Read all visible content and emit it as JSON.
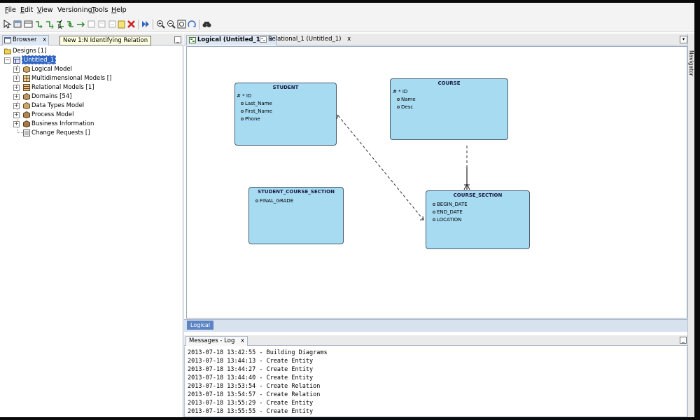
{
  "menubar": {
    "items": [
      {
        "label": "File",
        "mnemonic": "F",
        "rest": "ile"
      },
      {
        "label": "Edit",
        "mnemonic": "E",
        "rest": "dit"
      },
      {
        "label": "View",
        "mnemonic": "V",
        "rest": "iew"
      },
      {
        "label": "Versioning",
        "mnemonic": "",
        "rest": "Versioning"
      },
      {
        "label": "Tools",
        "mnemonic": "T",
        "rest": "ools"
      },
      {
        "label": "Help",
        "mnemonic": "H",
        "rest": "elp"
      }
    ]
  },
  "toolbar": {
    "tooltip": "New 1:N Identifying Relation",
    "icons": [
      "select-icon",
      "new-entity-icon",
      "new-view-icon",
      "new-relation-icon",
      "new-1n-relation-icon",
      "new-1n-identifying-relation-icon",
      "new-arc-icon",
      "new-fk-icon",
      "new-note-icon",
      "new-note2-icon",
      "new-note3-icon",
      "new-folder-icon",
      "delete-icon",
      "engineer-icon",
      "zoom-in-icon",
      "zoom-out-icon",
      "fit-screen-icon",
      "layout-icon",
      "find-icon"
    ]
  },
  "browser": {
    "tab_label": "Browser",
    "close": "x",
    "minimize": "_",
    "tree": {
      "root": "Designs [1]",
      "design": "Untitled_1",
      "children": [
        {
          "label": "Logical Model",
          "icon": "logical-model-icon",
          "expandable": true
        },
        {
          "label": "Multidimensional Models []",
          "icon": "multidimensional-icon",
          "expandable": true
        },
        {
          "label": "Relational Models [1]",
          "icon": "relational-models-icon",
          "expandable": true
        },
        {
          "label": "Domains [54]",
          "icon": "domains-icon",
          "expandable": true
        },
        {
          "label": "Data Types Model",
          "icon": "data-types-icon",
          "expandable": true
        },
        {
          "label": "Process Model",
          "icon": "process-model-icon",
          "expandable": true
        },
        {
          "label": "Business Information",
          "icon": "business-info-icon",
          "expandable": true
        },
        {
          "label": "Change Requests []",
          "icon": "change-requests-icon",
          "expandable": false
        }
      ]
    }
  },
  "editor": {
    "tabs": [
      {
        "label": "Logical (Untitled_1)",
        "active": true,
        "close": "x"
      },
      {
        "label": "Relational_1 (Untitled_1)",
        "active": false,
        "close": "x"
      }
    ],
    "menu_button": "▾",
    "navigator_label": "Navigator",
    "bottom_tab": "Logical"
  },
  "diagram": {
    "entities": [
      {
        "name": "STUDENT",
        "attributes": [
          "# * ID",
          "Last_Name",
          "First_Name",
          "Phone"
        ]
      },
      {
        "name": "COURSE",
        "attributes": [
          "# * ID",
          "Name",
          "Desc"
        ]
      },
      {
        "name": "STUDENT_COURSE_SECTION",
        "attributes": [
          "FINAL_GRADE"
        ]
      },
      {
        "name": "COURSE_SECTION",
        "attributes": [
          "BEGIN_DATE",
          "END_DATE",
          "LOCATION"
        ]
      }
    ],
    "relations": [
      {
        "from": "STUDENT",
        "to": "COURSE_SECTION",
        "style": "dashed"
      },
      {
        "from": "COURSE",
        "to": "COURSE_SECTION",
        "style": "dashed-solid"
      }
    ]
  },
  "messages": {
    "tab_label": "Messages - Log",
    "close": "x",
    "minimize": "_",
    "lines": [
      "2013-07-18 13:42:55 - Building Diagrams",
      "2013-07-18 13:44:13 - Create Entity",
      "2013-07-18 13:44:27 - Create Entity",
      "2013-07-18 13:44:40 - Create Entity",
      "2013-07-18 13:53:54 - Create Relation",
      "2013-07-18 13:54:57 - Create Relation",
      "2013-07-18 13:55:29 - Create Entity",
      "2013-07-18 13:55:55 - Create Entity"
    ]
  },
  "colors": {
    "entity_fill": "#a6dbf2",
    "entity_border": "#4a5b6e",
    "active_tab": "#5b84c4",
    "tooltip_bg": "#ffffe1"
  }
}
